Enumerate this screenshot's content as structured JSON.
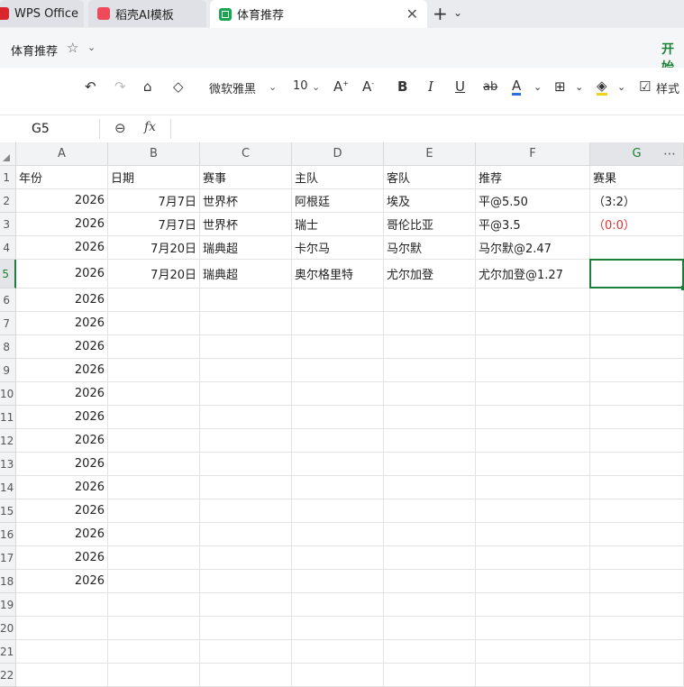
{
  "tabs": [
    {
      "label": "WPS Office"
    },
    {
      "label": "稻壳AI模板"
    },
    {
      "label": "体育推荐"
    }
  ],
  "title_row": {
    "doc_title": "体育推荐",
    "start_tab": "开始"
  },
  "toolbar": {
    "font_name": "微软雅黑",
    "font_size": "10",
    "style_label": "样式"
  },
  "formula_bar": {
    "name_box": "G5",
    "fx_label": "fx",
    "content": ""
  },
  "sheet": {
    "columns": [
      "A",
      "B",
      "C",
      "D",
      "E",
      "F",
      "G"
    ],
    "selected_column": "G",
    "active_cell": "G5",
    "rows": [
      {
        "n": "1",
        "cells": [
          "年份",
          "日期",
          "赛事",
          "主队",
          "客队",
          "推荐",
          "赛果"
        ]
      },
      {
        "n": "2",
        "cells": [
          "2026",
          "7月7日",
          "世界杯",
          "阿根廷",
          "埃及",
          "平@5.50",
          "（3:2）"
        ]
      },
      {
        "n": "3",
        "cells": [
          "2026",
          "7月7日",
          "世界杯",
          "瑞士",
          "哥伦比亚",
          "平@3.5",
          "（0:0）"
        ]
      },
      {
        "n": "4",
        "cells": [
          "2026",
          "7月20日",
          "瑞典超",
          "卡尔马",
          "马尔默",
          "马尔默@2.47",
          ""
        ]
      },
      {
        "n": "5",
        "cells": [
          "2026",
          "7月20日",
          "瑞典超",
          "奥尔格里特",
          "尤尔加登",
          "尤尔加登@1.27",
          ""
        ]
      },
      {
        "n": "6",
        "cells": [
          "2026",
          "",
          "",
          "",
          "",
          "",
          ""
        ]
      },
      {
        "n": "7",
        "cells": [
          "2026",
          "",
          "",
          "",
          "",
          "",
          ""
        ]
      },
      {
        "n": "8",
        "cells": [
          "2026",
          "",
          "",
          "",
          "",
          "",
          ""
        ]
      },
      {
        "n": "9",
        "cells": [
          "2026",
          "",
          "",
          "",
          "",
          "",
          ""
        ]
      },
      {
        "n": "10",
        "cells": [
          "2026",
          "",
          "",
          "",
          "",
          "",
          ""
        ]
      },
      {
        "n": "11",
        "cells": [
          "2026",
          "",
          "",
          "",
          "",
          "",
          ""
        ]
      },
      {
        "n": "12",
        "cells": [
          "2026",
          "",
          "",
          "",
          "",
          "",
          ""
        ]
      },
      {
        "n": "13",
        "cells": [
          "2026",
          "",
          "",
          "",
          "",
          "",
          ""
        ]
      },
      {
        "n": "14",
        "cells": [
          "2026",
          "",
          "",
          "",
          "",
          "",
          ""
        ]
      },
      {
        "n": "15",
        "cells": [
          "2026",
          "",
          "",
          "",
          "",
          "",
          ""
        ]
      },
      {
        "n": "16",
        "cells": [
          "2026",
          "",
          "",
          "",
          "",
          "",
          ""
        ]
      },
      {
        "n": "17",
        "cells": [
          "2026",
          "",
          "",
          "",
          "",
          "",
          ""
        ]
      },
      {
        "n": "18",
        "cells": [
          "2026",
          "",
          "",
          "",
          "",
          "",
          ""
        ]
      },
      {
        "n": "19",
        "cells": [
          "",
          "",
          "",
          "",
          "",
          "",
          ""
        ]
      },
      {
        "n": "20",
        "cells": [
          "",
          "",
          "",
          "",
          "",
          "",
          ""
        ]
      },
      {
        "n": "21",
        "cells": [
          "",
          "",
          "",
          "",
          "",
          "",
          ""
        ]
      },
      {
        "n": "22",
        "cells": [
          "",
          "",
          "",
          "",
          "",
          "",
          ""
        ]
      }
    ]
  },
  "colors": {
    "accent": "#1a7f37",
    "result_red": "#e03030"
  }
}
